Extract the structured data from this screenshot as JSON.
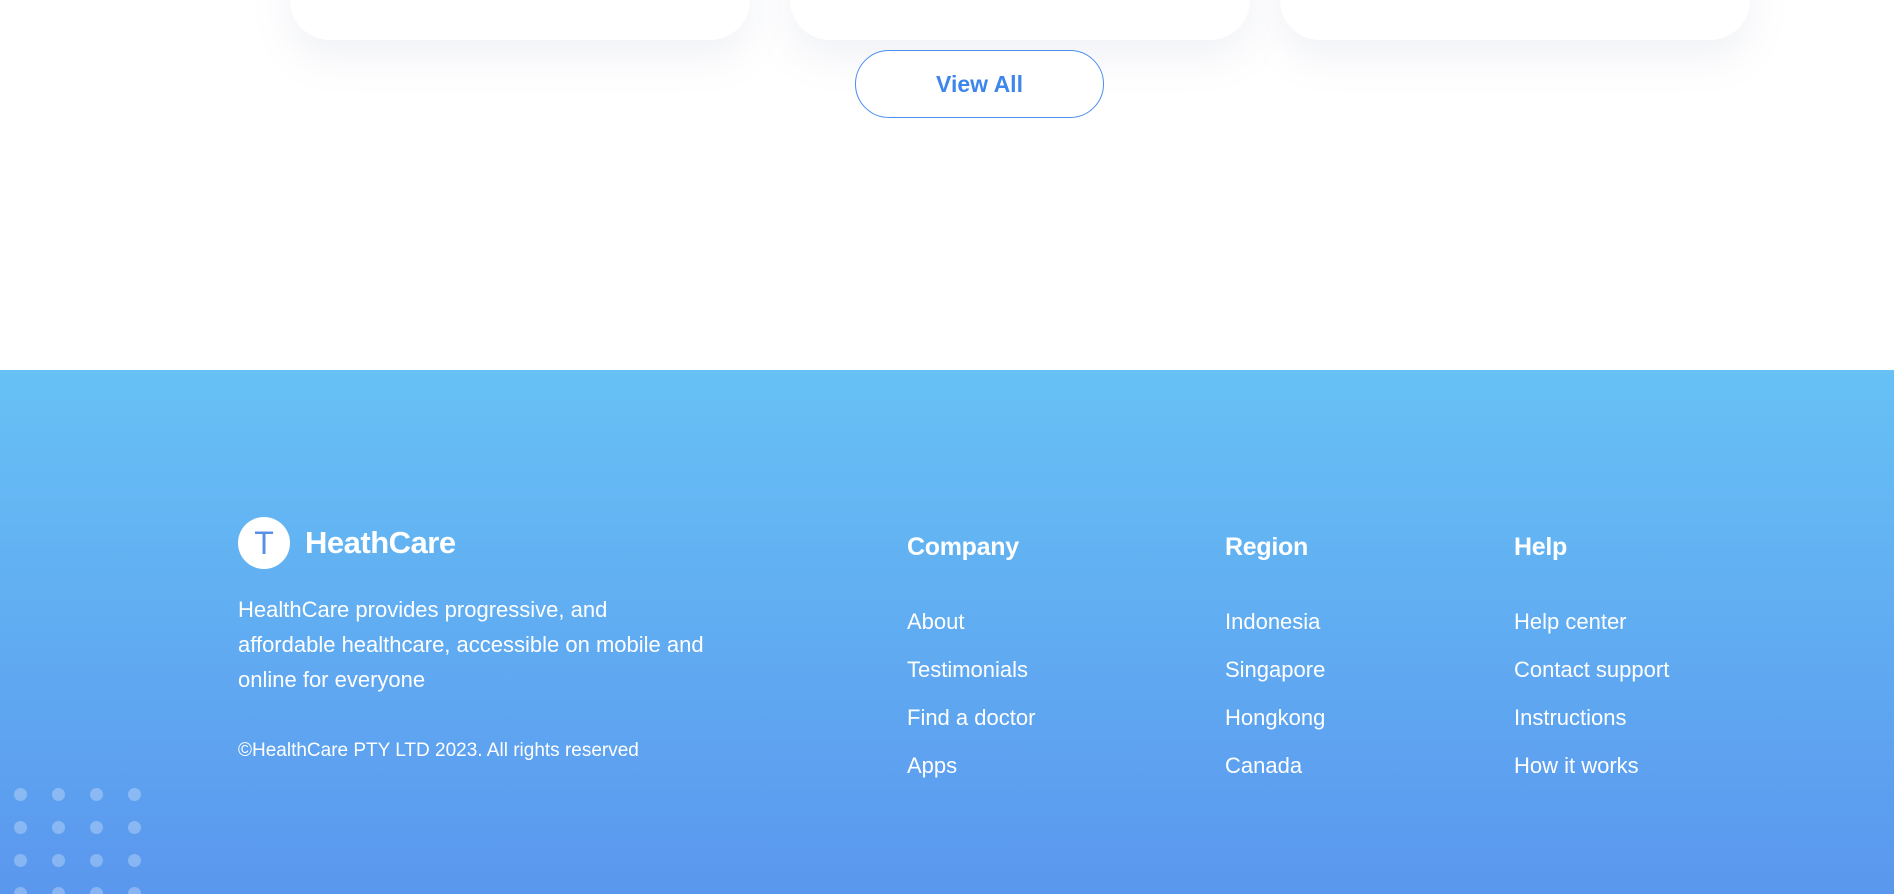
{
  "main": {
    "view_all_label": "View All"
  },
  "footer": {
    "logo_letter": "T",
    "brand_name": "HeathCare",
    "description": "HealthCare provides progressive, and affordable healthcare, accessible on mobile and online for everyone",
    "copyright": "©HealthCare PTY LTD 2023. All rights reserved",
    "columns": [
      {
        "title": "Company",
        "links": [
          "About",
          "Testimonials",
          "Find a doctor",
          "Apps"
        ]
      },
      {
        "title": "Region",
        "links": [
          "Indonesia",
          "Singapore",
          "Hongkong",
          "Canada"
        ]
      },
      {
        "title": "Help",
        "links": [
          "Help center",
          "Contact support",
          "Instructions",
          "How it works"
        ]
      }
    ]
  },
  "colors": {
    "accent": "#3d86ec",
    "footer_gradient_top": "#67c1f5",
    "footer_gradient_bottom": "#5a97ee"
  }
}
